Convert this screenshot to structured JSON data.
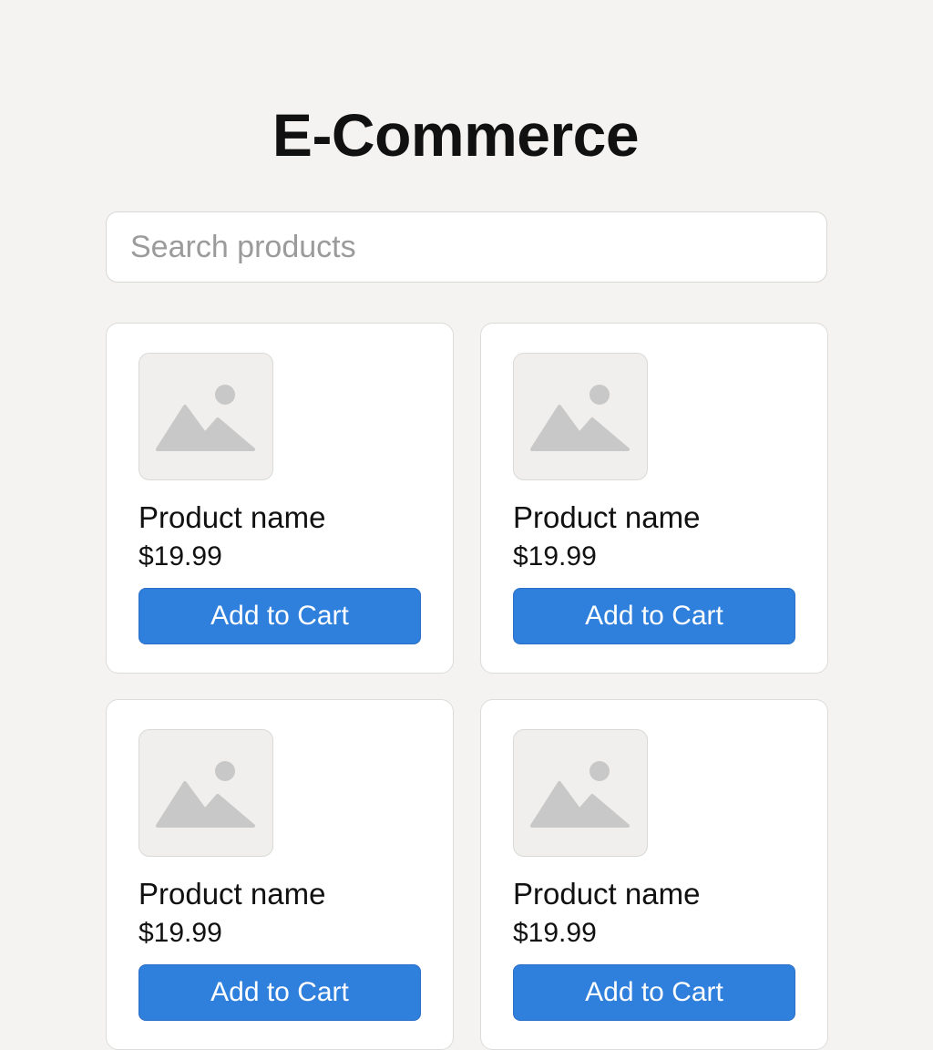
{
  "header": {
    "title": "E-Commerce"
  },
  "search": {
    "placeholder": "Search products",
    "value": ""
  },
  "products": [
    {
      "name": "Product name",
      "price": "$19.99",
      "button_label": "Add to Cart",
      "image_icon": "image-placeholder-icon"
    },
    {
      "name": "Product name",
      "price": "$19.99",
      "button_label": "Add to Cart",
      "image_icon": "image-placeholder-icon"
    },
    {
      "name": "Product name",
      "price": "$19.99",
      "button_label": "Add to Cart",
      "image_icon": "image-placeholder-icon"
    },
    {
      "name": "Product name",
      "price": "$19.99",
      "button_label": "Add to Cart",
      "image_icon": "image-placeholder-icon"
    }
  ],
  "colors": {
    "background": "#f4f3f1",
    "accent": "#2f7fdc",
    "card": "#ffffff",
    "placeholder_icon": "#c8c8c8"
  }
}
